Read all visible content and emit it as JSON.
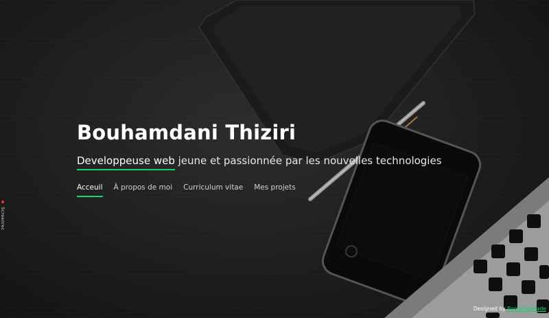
{
  "hero": {
    "name": "Bouhamdani Thiziri",
    "tagline_highlight": "Developpeuse web",
    "tagline_rest": " jeune et passionnée par les nouvelles technologies"
  },
  "nav": {
    "items": [
      {
        "label": "Acceuil",
        "active": true
      },
      {
        "label": "À propos de moi",
        "active": false
      },
      {
        "label": "Curriculum vitae",
        "active": false
      },
      {
        "label": "Mes projets",
        "active": false
      }
    ]
  },
  "side_badge": {
    "label": "Screenrec"
  },
  "credits": {
    "prefix": "Designed by ",
    "link": "BootstrapMade"
  },
  "colors": {
    "accent": "#18d26e",
    "background": "#1c1c1c"
  },
  "icons": {
    "notebook": "notebook-photo",
    "pen": "pen-photo",
    "phone": "smartphone-photo",
    "laptop": "laptop-keyboard-photo"
  }
}
